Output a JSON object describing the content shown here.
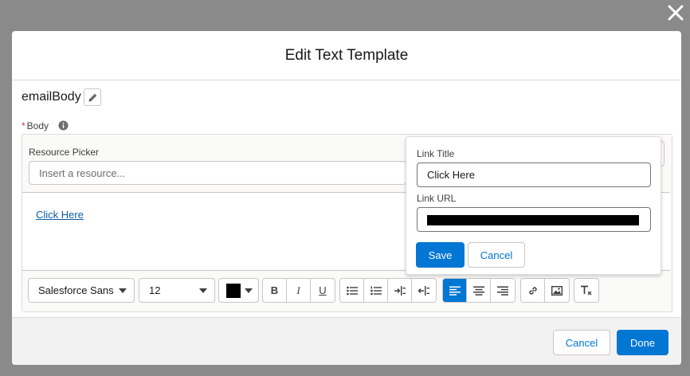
{
  "modal": {
    "title": "Edit Text Template"
  },
  "template": {
    "api_name": "emailBody",
    "body_label": "Body",
    "required_marker": "*"
  },
  "resource_picker": {
    "label": "Resource Picker",
    "placeholder": "Insert a resource..."
  },
  "editor": {
    "content_link_text": "Click Here",
    "toolbar": {
      "font_family": "Salesforce Sans",
      "font_size": "12",
      "text_color": "#000000"
    }
  },
  "link_popover": {
    "title_label": "Link Title",
    "title_value": "Click Here",
    "url_label": "Link URL",
    "url_value_redacted": true,
    "save_label": "Save",
    "cancel_label": "Cancel"
  },
  "footer": {
    "cancel_label": "Cancel",
    "done_label": "Done"
  },
  "colors": {
    "brand": "#0176d3",
    "overlay": "#8a8a8a",
    "link": "#0b5cab",
    "required": "#c23934"
  }
}
